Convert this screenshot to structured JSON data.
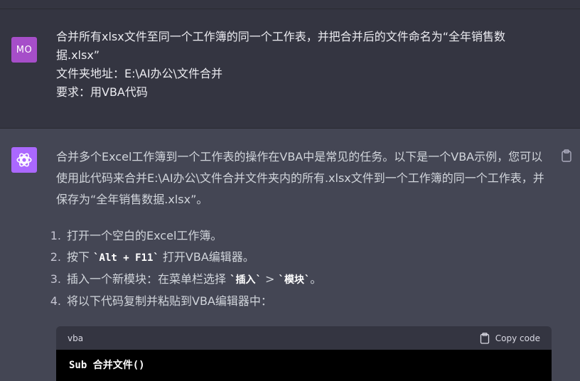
{
  "user": {
    "avatar_initials": "MO",
    "lines": [
      "合并所有xlsx文件至同一个工作簿的同一个工作表，并把合并后的文件命名为“全年销售数据.xlsx”",
      "文件夹地址：E:\\AI办公\\文件合并",
      "要求：用VBA代码"
    ]
  },
  "assistant": {
    "intro": "合并多个Excel工作簿到一个工作表的操作在VBA中是常见的任务。以下是一个VBA示例，您可以使用此代码来合并E:\\AI办公\\文件合并文件夹内的所有.xlsx文件到一个工作簿的同一个工作表，并保存为“全年销售数据.xlsx”。",
    "steps": [
      {
        "num": "1.",
        "pre": "打开一个空白的Excel工作簿。",
        "code": "",
        "post": ""
      },
      {
        "num": "2.",
        "pre": "按下 ",
        "code": "`Alt + F11`",
        "post": " 打开VBA编辑器。"
      },
      {
        "num": "3.",
        "pre": "插入一个新模块：在菜单栏选择 ",
        "code": "`插入`",
        "post": " > ",
        "code2": "`模块`",
        "post2": "。"
      },
      {
        "num": "4.",
        "pre": "将以下代码复制并粘贴到VBA编辑器中：",
        "code": "",
        "post": ""
      }
    ],
    "code_block": {
      "language": "vba",
      "copy_label": "Copy code",
      "first_line": "Sub 合并文件()"
    }
  },
  "colors": {
    "user_bg": "#343541",
    "assistant_bg": "#444654",
    "user_avatar": "#a64ec9",
    "bot_avatar": "#ab68ff",
    "code_bg": "#000000"
  }
}
